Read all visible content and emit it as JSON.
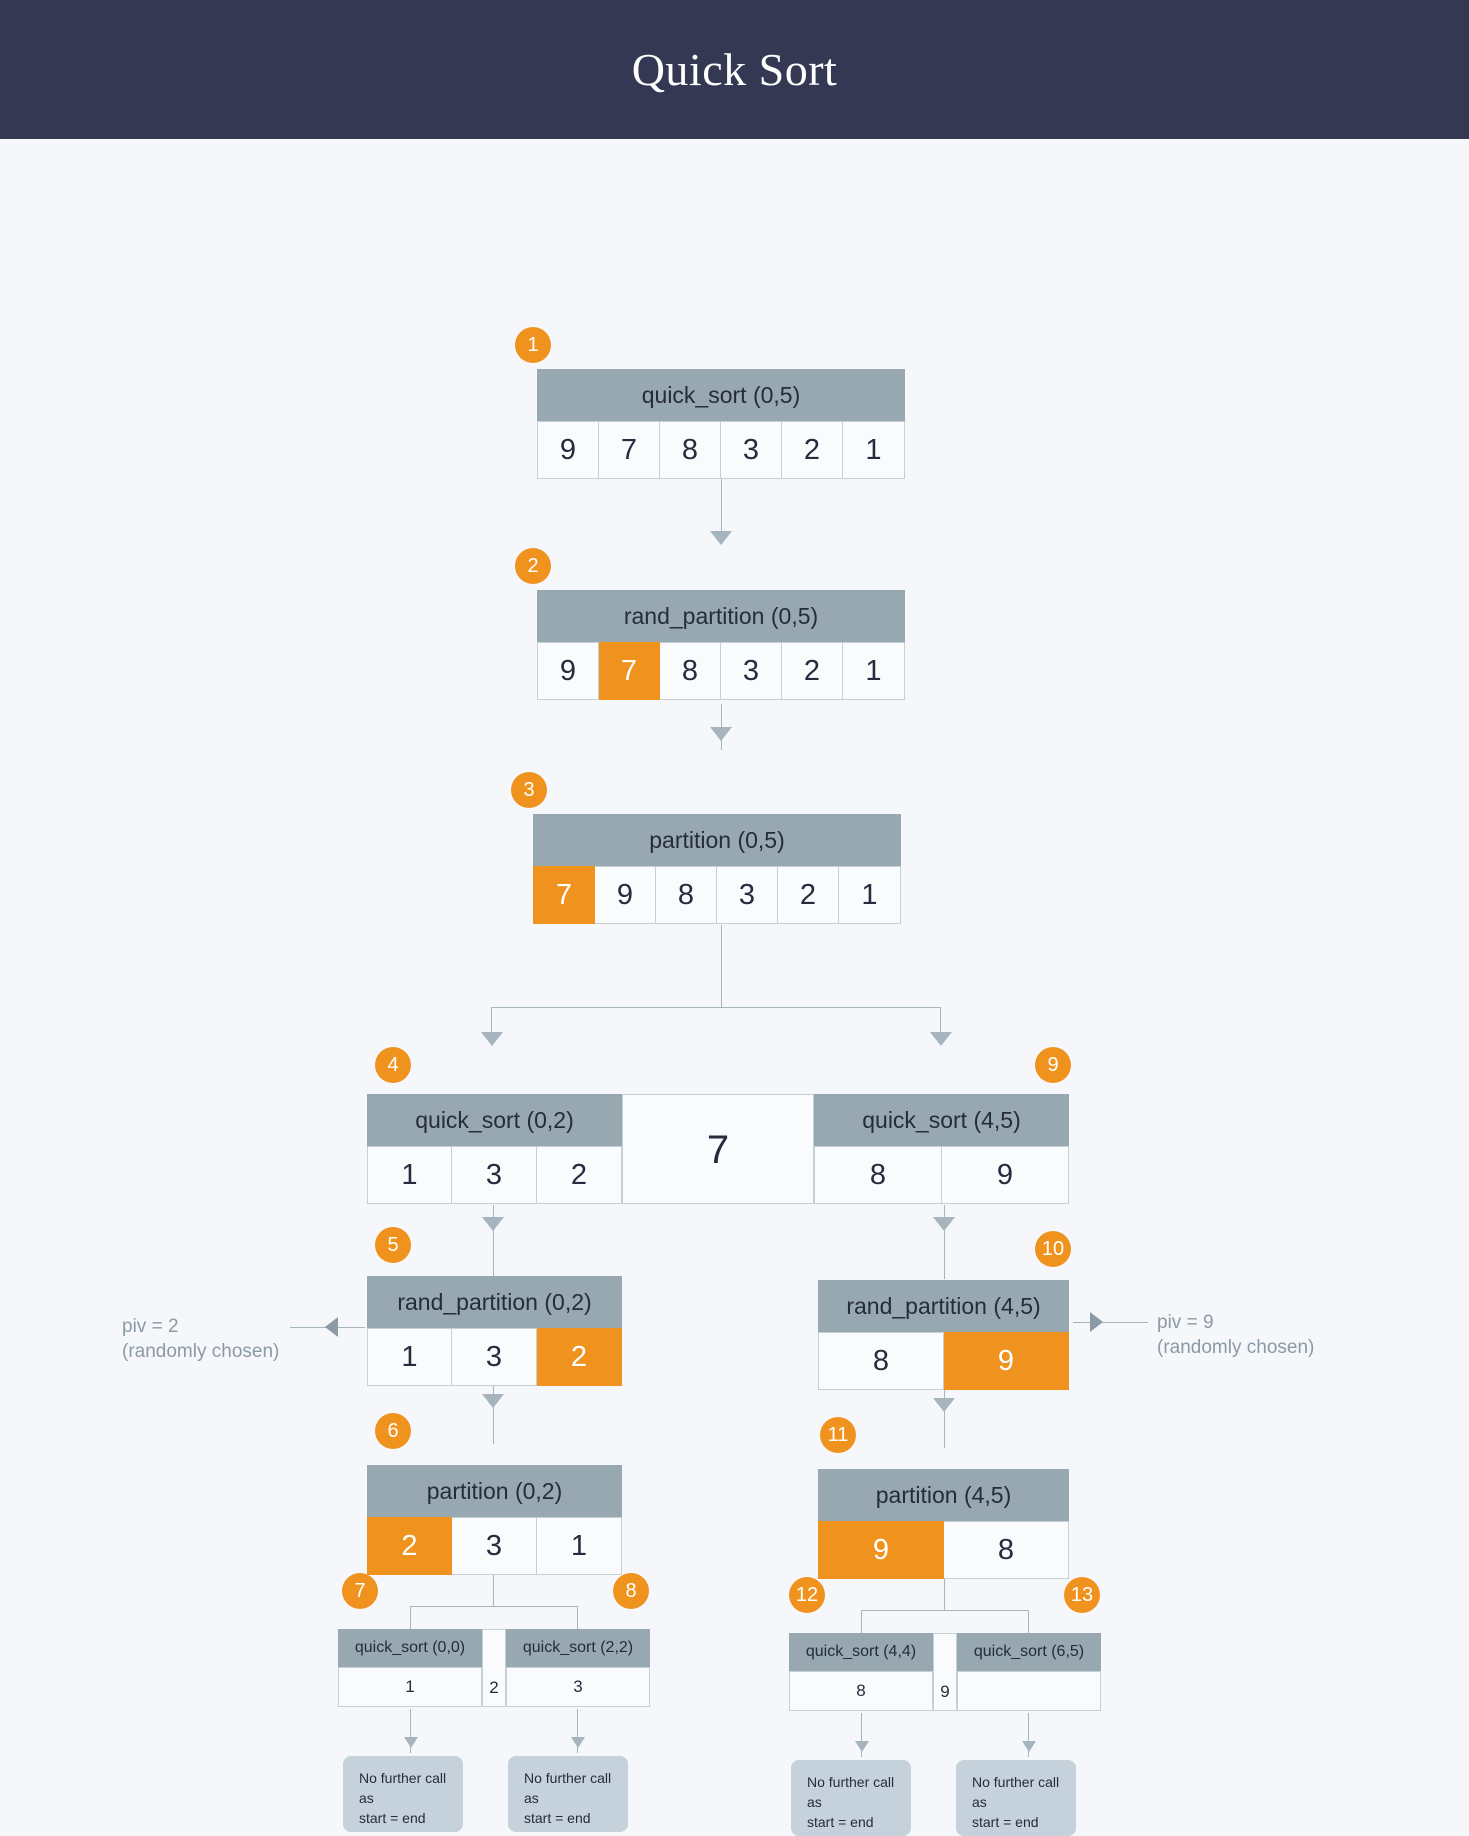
{
  "header": {
    "title": "Quick Sort"
  },
  "annotations": {
    "piv_left_line1": "piv = 2",
    "piv_left_line2": "(randomly chosen)",
    "piv_right_line1": "piv = 9",
    "piv_right_line2": "(randomly chosen)"
  },
  "terminal_note": {
    "line1": "No further call",
    "line2": "as",
    "line3": "start = end"
  },
  "mid_pivot_value": "7",
  "nodes": {
    "n1": {
      "badge": "1",
      "title": "quick_sort (0,5)",
      "cells": [
        "9",
        "7",
        "8",
        "3",
        "2",
        "1"
      ],
      "pivot_index": -1
    },
    "n2": {
      "badge": "2",
      "title": "rand_partition (0,5)",
      "cells": [
        "9",
        "7",
        "8",
        "3",
        "2",
        "1"
      ],
      "pivot_index": 1
    },
    "n3": {
      "badge": "3",
      "title": "partition (0,5)",
      "cells": [
        "7",
        "9",
        "8",
        "3",
        "2",
        "1"
      ],
      "pivot_index": 0
    },
    "n4": {
      "badge": "4",
      "title": "quick_sort (0,2)",
      "cells": [
        "1",
        "3",
        "2"
      ],
      "pivot_index": -1
    },
    "n9": {
      "badge": "9",
      "title": "quick_sort (4,5)",
      "cells": [
        "8",
        "9"
      ],
      "pivot_index": -1
    },
    "n5": {
      "badge": "5",
      "title": "rand_partition (0,2)",
      "cells": [
        "1",
        "3",
        "2"
      ],
      "pivot_index": 2
    },
    "n10": {
      "badge": "10",
      "title": "rand_partition (4,5)",
      "cells": [
        "8",
        "9"
      ],
      "pivot_index": 1
    },
    "n6": {
      "badge": "6",
      "title": "partition (0,2)",
      "cells": [
        "2",
        "3",
        "1"
      ],
      "pivot_index": 0
    },
    "n11": {
      "badge": "11",
      "title": "partition (4,5)",
      "cells": [
        "9",
        "8"
      ],
      "pivot_index": 0
    },
    "n7": {
      "badge": "7",
      "title": "quick_sort (0,0)",
      "cells": [
        "1"
      ],
      "pivot_index": -1
    },
    "n8": {
      "badge": "8",
      "title": "quick_sort (2,2)",
      "cells": [
        "3"
      ],
      "pivot_index": -1
    },
    "n12": {
      "badge": "12",
      "title": "quick_sort (4,4)",
      "cells": [
        "8"
      ],
      "pivot_index": -1
    },
    "n13": {
      "badge": "13",
      "title": "quick_sort (6,5)",
      "cells": [
        ""
      ],
      "pivot_index": -1
    }
  },
  "separator_values": {
    "left_bottom": "2",
    "right_bottom": "9"
  },
  "colors": {
    "header_bg": "#343853",
    "page_bg": "#f5f7fb",
    "node_title_bg": "#97a8b0",
    "pivot": "#f0931e",
    "connector": "#a6b4bd",
    "text": "#262b3d",
    "muted": "#8b9aa5",
    "stop_bg": "#c5d2dc"
  }
}
